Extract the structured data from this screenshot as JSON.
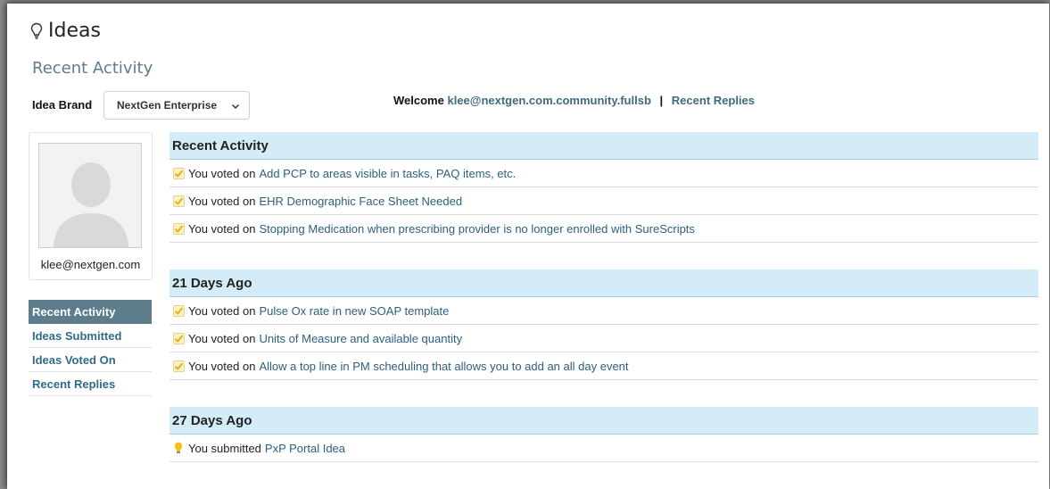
{
  "header": {
    "title": "Ideas",
    "subtitle": "Recent Activity"
  },
  "brand": {
    "label": "Idea Brand",
    "selected": "NextGen Enterprise"
  },
  "welcome": {
    "prefix": "Welcome",
    "user": "klee@nextgen.com.community.fullsb",
    "separator": "|",
    "replies_link": "Recent Replies"
  },
  "profile": {
    "name": "klee@nextgen.com"
  },
  "sidebar": {
    "items": [
      {
        "label": "Recent Activity",
        "active": true
      },
      {
        "label": "Ideas Submitted",
        "active": false
      },
      {
        "label": "Ideas Voted On",
        "active": false
      },
      {
        "label": "Recent Replies",
        "active": false
      }
    ]
  },
  "feed": {
    "sections": [
      {
        "heading": "Recent Activity",
        "rows": [
          {
            "icon": "checkmark-icon",
            "action": "You voted on",
            "link": "Add PCP to areas visible in tasks, PAQ items, etc."
          },
          {
            "icon": "checkmark-icon",
            "action": "You voted on",
            "link": "EHR Demographic Face Sheet Needed"
          },
          {
            "icon": "checkmark-icon",
            "action": "You voted on",
            "link": "Stopping Medication when prescribing provider is no longer enrolled with SureScripts"
          }
        ]
      },
      {
        "heading": "21 Days Ago",
        "rows": [
          {
            "icon": "checkmark-icon",
            "action": "You voted on",
            "link": "Pulse Ox rate in new SOAP template"
          },
          {
            "icon": "checkmark-icon",
            "action": "You voted on",
            "link": "Units of Measure and available quantity"
          },
          {
            "icon": "checkmark-icon",
            "action": "You voted on",
            "link": "Allow a top line in PM scheduling that allows you to add an all day event"
          }
        ]
      },
      {
        "heading": "27 Days Ago",
        "rows": [
          {
            "icon": "lightbulb-icon",
            "action": "You submitted",
            "link": "PxP Portal Idea"
          }
        ]
      }
    ]
  },
  "colors": {
    "accent": "#5d7c8c",
    "link": "#2d5f80",
    "section_bg": "#d4ecf7"
  }
}
